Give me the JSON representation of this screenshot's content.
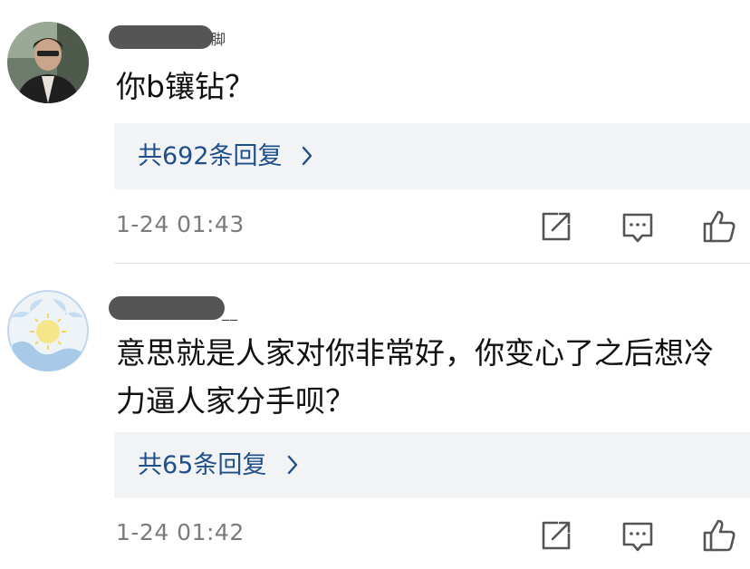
{
  "comments": [
    {
      "name_tail": "脚",
      "text_lines": [
        "你b镶钻？"
      ],
      "replies_label": "共692条回复",
      "time": "1-24 01:43"
    },
    {
      "name_tail": "__",
      "text_lines": [
        "意思就是人家对你非常好，你变心了之后想冷",
        "力逼人家分手呗？"
      ],
      "replies_label": "共65条回复",
      "time": "1-24 01:42"
    }
  ],
  "icons": {
    "share": "share-icon",
    "comment": "comment-icon",
    "like": "thumbs-up-icon"
  },
  "colors": {
    "reply_text": "#1e4f8a",
    "reply_bg": "#f2f3f5",
    "timestamp": "#7b7b7b"
  }
}
